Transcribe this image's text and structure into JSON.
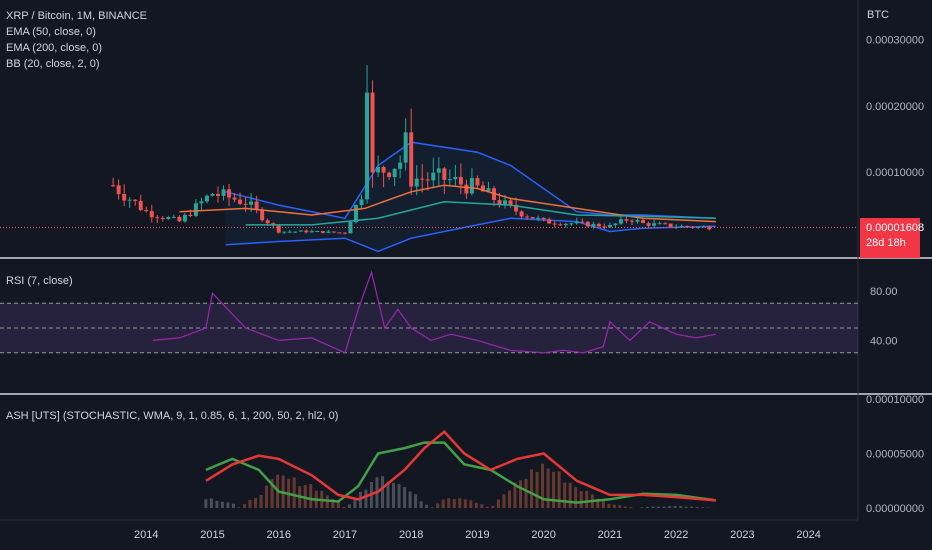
{
  "legend": {
    "main": [
      "XRP / Bitcoin, 1M, BINANCE",
      "EMA (50, close, 0)",
      "EMA (200, close, 0)",
      "BB (20, close, 2, 0)"
    ],
    "rsi": "RSI (7, close)",
    "ash": "ASH [UTS] (STOCHASTIC, WMA, 9, 1, 0.85, 6, 1, 200, 50, 2, hl2, 0)"
  },
  "price_scale": {
    "unit": "BTC",
    "last_price": "0.00001608",
    "countdown": "28d 18h"
  },
  "colors": {
    "background": "#131722",
    "up": "#26a69a",
    "down": "#ef5350",
    "ema50": "#f0703c",
    "ema200": "#26a69a",
    "bb": "#2962ff",
    "rsi": "#9c27b0",
    "ash_bull": "#43a047",
    "ash_bear": "#e53935"
  },
  "chart_data": [
    {
      "type": "candlestick",
      "title": "XRP / Bitcoin, 1M, BINANCE",
      "x_ticks": [
        "2014",
        "2015",
        "2016",
        "2017",
        "2018",
        "2019",
        "2020",
        "2021",
        "2022",
        "2023",
        "2024"
      ],
      "y_ticks": [
        "0.00010000",
        "0.00020000",
        "0.00030000"
      ],
      "ylim": [
        -3e-05,
        0.00036
      ],
      "series": [
        {
          "indicator": "XRP/BTC close",
          "x": [
            2013.5,
            2014.0,
            2014.5,
            2015.0,
            2015.5,
            2016.0,
            2016.5,
            2017.0,
            2017.3,
            2017.5,
            2017.9,
            2018.0,
            2018.5,
            2019.0,
            2019.5,
            2020.0,
            2020.5,
            2021.0,
            2021.3,
            2021.5,
            2022.0,
            2022.5
          ],
          "y": [
            8e-05,
            4e-05,
            2.5e-05,
            6.8e-05,
            5.5e-05,
            1e-05,
            1e-05,
            8e-06,
            8e-05,
            0.0001,
            0.00012,
            9e-05,
            9e-05,
            7.5e-05,
            4.5e-05,
            2.5e-05,
            2.2e-05,
            1.8e-05,
            3e-05,
            2.2e-05,
            1.8e-05,
            1.608e-05
          ]
        },
        {
          "indicator": "EMA (50, close, 0)",
          "x": [
            2014.5,
            2015.5,
            2016.5,
            2017.3,
            2018.0,
            2018.5,
            2019.0,
            2019.5,
            2020.5,
            2021.5,
            2022.6
          ],
          "y": [
            4e-05,
            4.5e-05,
            3.5e-05,
            4.5e-05,
            7e-05,
            8e-05,
            7.5e-05,
            6e-05,
            4.5e-05,
            3e-05,
            2.5e-05
          ]
        },
        {
          "indicator": "EMA (200, close, 0)",
          "x": [
            2015.5,
            2016.5,
            2017.5,
            2018.5,
            2019.5,
            2020.5,
            2021.5,
            2022.6
          ],
          "y": [
            2e-05,
            2e-05,
            3e-05,
            5.5e-05,
            5e-05,
            3.5e-05,
            3.3e-05,
            3e-05
          ]
        },
        {
          "indicator": "BB upper",
          "x": [
            2015.2,
            2016.0,
            2017.0,
            2017.5,
            2018.0,
            2019.0,
            2019.5,
            2020.5,
            2021.0,
            2021.5,
            2022.6
          ],
          "y": [
            7e-05,
            5e-05,
            3e-05,
            0.00011,
            0.000145,
            0.00013,
            0.00011,
            4e-05,
            3.5e-05,
            3.5e-05,
            3e-05
          ]
        },
        {
          "indicator": "BB lower",
          "x": [
            2015.2,
            2016.0,
            2017.0,
            2017.5,
            2018.0,
            2019.0,
            2019.5,
            2020.5,
            2021.0,
            2021.5,
            2022.6
          ],
          "y": [
            -1e-05,
            -5e-06,
            0.0,
            -2e-05,
            0.0,
            2e-05,
            3e-05,
            2.5e-05,
            1e-05,
            1.5e-05,
            1.8e-05
          ]
        }
      ]
    },
    {
      "type": "line",
      "title": "RSI (7, close)",
      "y_ticks": [
        "40.00",
        "80.00"
      ],
      "ylim": [
        0,
        100
      ],
      "bands": [
        30,
        50,
        70
      ],
      "x": [
        2014.1,
        2014.5,
        2014.9,
        2015.0,
        2015.5,
        2016.0,
        2016.5,
        2017.0,
        2017.2,
        2017.4,
        2017.6,
        2017.8,
        2018.0,
        2018.3,
        2018.6,
        2019.0,
        2019.5,
        2020.0,
        2020.3,
        2020.6,
        2020.9,
        2021.0,
        2021.3,
        2021.6,
        2022.0,
        2022.3,
        2022.6
      ],
      "y": [
        40,
        42,
        50,
        78,
        50,
        40,
        42,
        30,
        65,
        95,
        50,
        65,
        50,
        40,
        45,
        40,
        32,
        30,
        32,
        30,
        35,
        55,
        40,
        55,
        45,
        42,
        45
      ]
    },
    {
      "type": "line",
      "title": "ASH [UTS] (STOCHASTIC, WMA, 9, 1, 0.85, 6, 1, 200, 50, 2, hl2, 0)",
      "y_ticks": [
        "0.00000000",
        "0.00005000",
        "0.00010000"
      ],
      "ylim": [
        0,
        0.0001
      ],
      "series": [
        {
          "indicator": "bull",
          "x": [
            2014.9,
            2015.3,
            2015.7,
            2016.0,
            2016.5,
            2016.9,
            2017.2,
            2017.5,
            2017.9,
            2018.2,
            2018.5,
            2018.8,
            2019.2,
            2019.6,
            2020.0,
            2020.5,
            2021.0,
            2021.5,
            2022.0,
            2022.6
          ],
          "y": [
            3.5e-05,
            4.5e-05,
            3.5e-05,
            1.5e-05,
            8e-06,
            6e-06,
            2e-05,
            5e-05,
            5.5e-05,
            6e-05,
            6e-05,
            4e-05,
            3.5e-05,
            2e-05,
            8e-06,
            5e-06,
            8e-06,
            1.3e-05,
            1.2e-05,
            7e-06
          ]
        },
        {
          "indicator": "bear",
          "x": [
            2014.9,
            2015.3,
            2015.7,
            2016.0,
            2016.5,
            2016.9,
            2017.2,
            2017.5,
            2017.9,
            2018.2,
            2018.5,
            2018.8,
            2019.2,
            2019.6,
            2020.0,
            2020.5,
            2021.0,
            2021.5,
            2022.0,
            2022.6
          ],
          "y": [
            2.5e-05,
            4e-05,
            4.8e-05,
            4.5e-05,
            3e-05,
            1.2e-05,
            8e-06,
            1.5e-05,
            3.5e-05,
            5.5e-05,
            7e-05,
            5e-05,
            3.5e-05,
            4.5e-05,
            5e-05,
            2.5e-05,
            1.2e-05,
            1.2e-05,
            1e-05,
            7e-06
          ]
        }
      ]
    }
  ]
}
